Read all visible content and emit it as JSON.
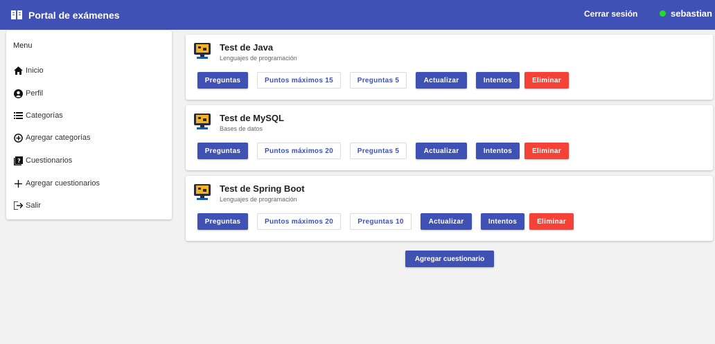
{
  "header": {
    "title": "Portal de exámenes",
    "logout_label": "Cerrar sesión",
    "username": "sebastian",
    "status_color": "#22dd22"
  },
  "sidebar": {
    "title": "Menu",
    "items": [
      {
        "label": "Inicio",
        "icon": "home-icon"
      },
      {
        "label": "Perfil",
        "icon": "account-circle-icon"
      },
      {
        "label": "Categorías",
        "icon": "list-icon"
      },
      {
        "label": "Agregar categorías",
        "icon": "add-circle-outline-icon"
      },
      {
        "label": "Cuestionarios",
        "icon": "quiz-icon"
      },
      {
        "label": "Agregar cuestionarios",
        "icon": "plus-icon"
      },
      {
        "label": "Salir",
        "icon": "logout-icon"
      }
    ]
  },
  "quizzes": [
    {
      "title": "Test de Java",
      "category": "Lenguajes de programación",
      "questions_label": "Preguntas",
      "max_points_label": "Puntos máximos 15",
      "question_count_label": "Preguntas 5",
      "update_label": "Actualizar",
      "attempts_label": "Intentos",
      "delete_label": "Eliminar"
    },
    {
      "title": "Test de MySQL",
      "category": "Bases de datos",
      "questions_label": "Preguntas",
      "max_points_label": "Puntos máximos 20",
      "question_count_label": "Preguntas 5",
      "update_label": "Actualizar",
      "attempts_label": "Intentos",
      "delete_label": "Eliminar"
    },
    {
      "title": "Test de Spring Boot",
      "category": "Lenguajes de programación",
      "questions_label": "Preguntas",
      "max_points_label": "Puntos máximos 20",
      "question_count_label": "Preguntas 10",
      "update_label": "Actualizar",
      "attempts_label": "Intentos",
      "delete_label": "Eliminar"
    }
  ],
  "add_quiz_label": "Agregar cuestionario",
  "colors": {
    "primary": "#3f51b5",
    "warn": "#f44336",
    "background": "#f2f2f2"
  }
}
